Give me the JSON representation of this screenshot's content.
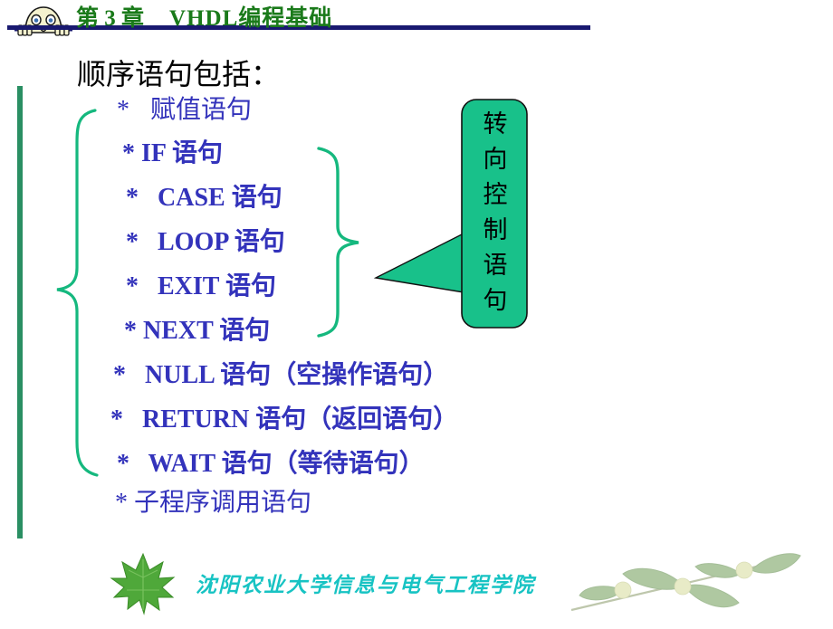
{
  "header": {
    "chapter_label": "第 3 章",
    "title": "VHDL编程基础",
    "icon": "cartoon-face-icon",
    "rule_color": "#191970",
    "title_color": "#1a7a1a"
  },
  "main": {
    "heading": "顺序语句包括：",
    "heading_color": "#000000",
    "item_color": "#3333bb",
    "items": [
      {
        "marker": "*",
        "text": "赋值语句",
        "bold": false
      },
      {
        "marker": "*",
        "text": "IF  语句",
        "bold": true
      },
      {
        "marker": "*",
        "text": "CASE  语句",
        "bold": true
      },
      {
        "marker": "*",
        "text": "LOOP  语句",
        "bold": true
      },
      {
        "marker": "*",
        "text": "EXIT  语句",
        "bold": true
      },
      {
        "marker": "*",
        "text": "NEXT  语句",
        "bold": true
      },
      {
        "marker": "*",
        "text": "NULL  语句（空操作语句）",
        "bold": true
      },
      {
        "marker": "*",
        "text": "RETURN  语句（返回语句）",
        "bold": true
      },
      {
        "marker": "*",
        "text": "WAIT  语句（等待语句）",
        "bold": true
      },
      {
        "marker": "*",
        "text": "子程序调用语句",
        "bold": false
      }
    ]
  },
  "callout": {
    "lines": [
      "转",
      "向",
      "控",
      "制",
      "语",
      "句"
    ],
    "fill_color": "#18c18a",
    "text_color": "#000000"
  },
  "decorations": {
    "brace_color": "#15b87e",
    "left_bar_color": "#2a8f63"
  },
  "footer": {
    "institution": "沈阳农业大学信息与电气工程学院",
    "text_color": "#17c3c3",
    "left_icon": "maple-leaf-icon",
    "right_icon": "leafy-branch-icon"
  }
}
